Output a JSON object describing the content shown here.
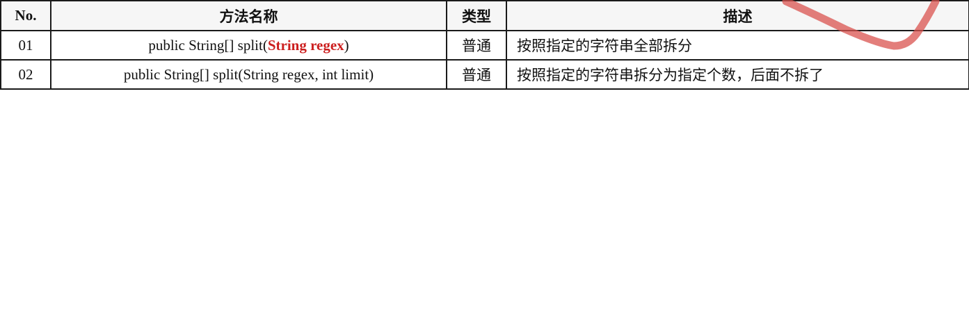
{
  "table": {
    "headers": [
      "No.",
      "方法名称",
      "类型",
      "描述"
    ],
    "rows": [
      {
        "no": "01",
        "method_prefix": "public String[] split(",
        "method_highlight": "String regex",
        "method_suffix": ")",
        "type": "普通",
        "desc": "按照指定的字符串全部拆分"
      },
      {
        "no": "02",
        "method_prefix": "public String[] split(String regex, int limit)",
        "method_highlight": "",
        "method_suffix": "",
        "type": "普通",
        "desc": "按照指定的字符串拆分为指定个数，后面不拆了"
      }
    ]
  },
  "colors": {
    "highlight_text": "#cc1f1f",
    "annotation_stroke": "#d9534f"
  }
}
